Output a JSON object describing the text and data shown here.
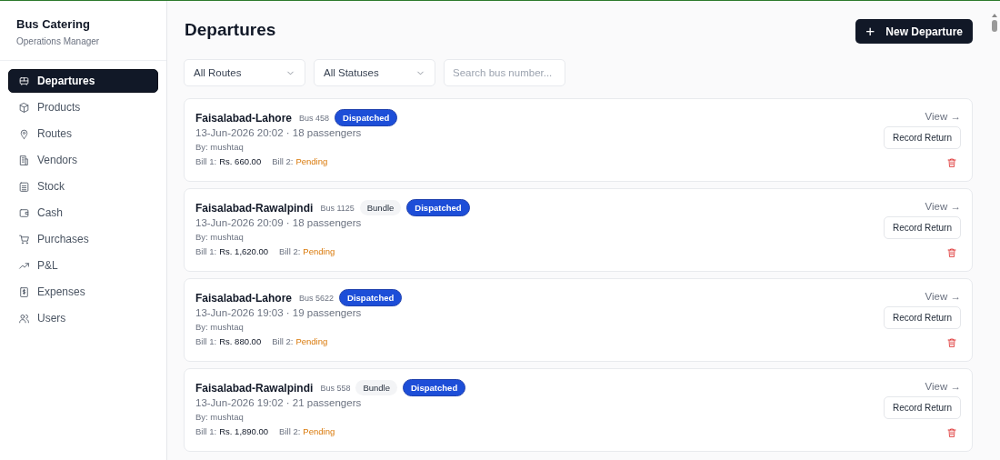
{
  "sidebar": {
    "app_title": "Bus Catering",
    "app_subtitle": "Operations Manager",
    "items": [
      {
        "label": "Departures",
        "selected": true
      },
      {
        "label": "Products",
        "selected": false
      },
      {
        "label": "Routes",
        "selected": false
      },
      {
        "label": "Vendors",
        "selected": false
      },
      {
        "label": "Stock",
        "selected": false
      },
      {
        "label": "Cash",
        "selected": false
      },
      {
        "label": "Purchases",
        "selected": false
      },
      {
        "label": "P&L",
        "selected": false
      },
      {
        "label": "Expenses",
        "selected": false
      },
      {
        "label": "Users",
        "selected": false
      }
    ]
  },
  "header": {
    "title": "Departures",
    "new_button": "New Departure",
    "new_button_icon": "+"
  },
  "filters": {
    "route_select": "All Routes",
    "status_select": "All Statuses",
    "search": {
      "placeholder": "Search bus number..."
    }
  },
  "departures": [
    {
      "route": "Faisalabad-Lahore",
      "bus": "Bus 458",
      "badges": [
        {
          "kind": "status",
          "text": "Dispatched"
        }
      ],
      "when": "13-Jun-2026 20:02 · 18 passengers",
      "by": "By: mushtaq",
      "bill1_label": "Bill 1:",
      "bill1_value": "Rs. 660.00",
      "bill2_label": "Bill 2:",
      "bill2_value": "Pending",
      "view": "View →",
      "action": "Record Return"
    },
    {
      "route": "Faisalabad-Rawalpindi",
      "bus": "Bus 1125",
      "badges": [
        {
          "kind": "tag",
          "text": "Bundle"
        },
        {
          "kind": "status",
          "text": "Dispatched"
        }
      ],
      "when": "13-Jun-2026 20:09 · 18 passengers",
      "by": "By: mushtaq",
      "bill1_label": "Bill 1:",
      "bill1_value": "Rs. 1,620.00",
      "bill2_label": "Bill 2:",
      "bill2_value": "Pending",
      "view": "View →",
      "action": "Record Return"
    },
    {
      "route": "Faisalabad-Lahore",
      "bus": "Bus 5622",
      "badges": [
        {
          "kind": "status",
          "text": "Dispatched"
        }
      ],
      "when": "13-Jun-2026 19:03 · 19 passengers",
      "by": "By: mushtaq",
      "bill1_label": "Bill 1:",
      "bill1_value": "Rs. 880.00",
      "bill2_label": "Bill 2:",
      "bill2_value": "Pending",
      "view": "View →",
      "action": "Record Return"
    },
    {
      "route": "Faisalabad-Rawalpindi",
      "bus": "Bus 558",
      "badges": [
        {
          "kind": "tag",
          "text": "Bundle"
        },
        {
          "kind": "status",
          "text": "Dispatched"
        }
      ],
      "when": "13-Jun-2026 19:02 · 21 passengers",
      "by": "By: mushtaq",
      "bill1_label": "Bill 1:",
      "bill1_value": "Rs. 1,890.00",
      "bill2_label": "Bill 2:",
      "bill2_value": "Pending",
      "view": "View →",
      "action": "Record Return"
    }
  ]
}
